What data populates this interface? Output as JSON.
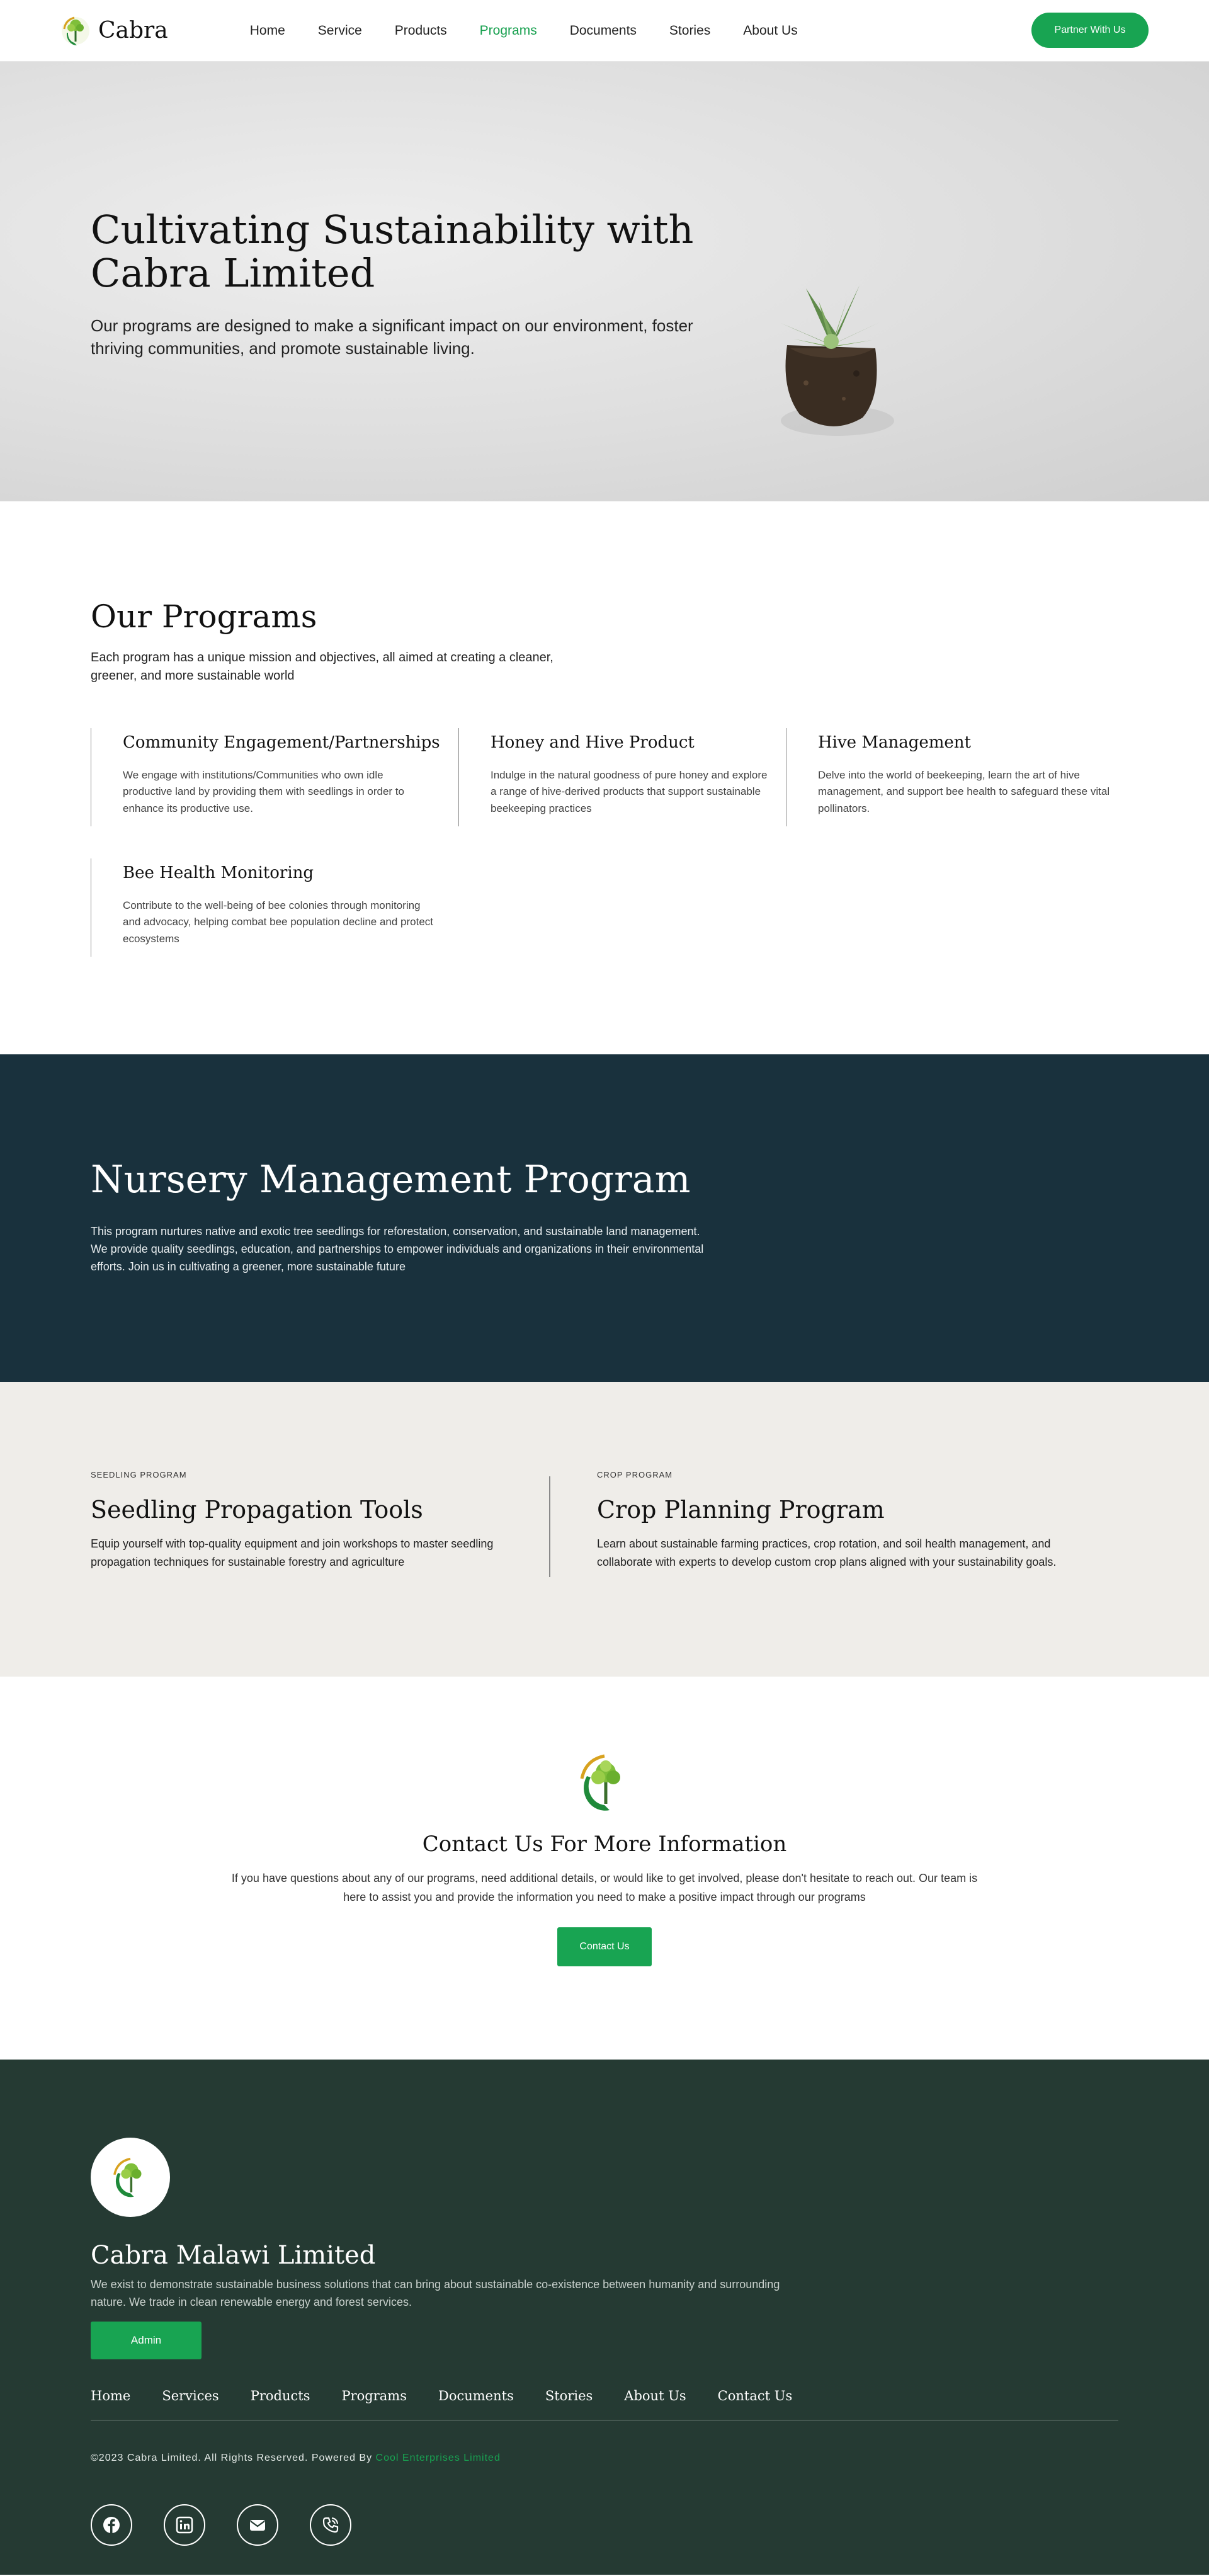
{
  "brand": {
    "name": "Cabra",
    "logo_icon": "tree-logo-icon"
  },
  "nav": {
    "links": [
      "Home",
      "Service",
      "Products",
      "Programs",
      "Documents",
      "Stories",
      "About Us"
    ],
    "active": "Programs",
    "cta": "Partner With Us"
  },
  "hero": {
    "title": "Cultivating Sustainability with Cabra Limited",
    "subtitle": "Our programs are designed to make a significant impact on our environment, foster thriving communities, and promote sustainable living."
  },
  "programs": {
    "title": "Our Programs",
    "subtitle": "Each program has a unique mission and objectives, all aimed at creating a cleaner, greener, and more sustainable world",
    "items": [
      {
        "title": "Community Engagement/Partnerships",
        "text": "We engage with institutions/Communities who own idle productive land by providing them with seedlings in order to enhance its productive use."
      },
      {
        "title": "Honey and Hive Product",
        "text": "Indulge in the natural goodness of pure honey and explore a range of hive-derived products that support sustainable beekeeping practices"
      },
      {
        "title": "Hive Management",
        "text": "Delve into the world of beekeeping, learn the art of hive management, and support bee health to safeguard these vital pollinators."
      },
      {
        "title": "Bee Health Monitoring",
        "text": "Contribute to the well-being of bee colonies through monitoring and advocacy, helping combat bee population decline and protect ecosystems"
      }
    ]
  },
  "nursery": {
    "title": "Nursery Management Program",
    "text": "This program nurtures native and exotic tree seedlings for reforestation, conservation, and sustainable land management. We provide quality seedlings, education, and partnerships to empower individuals and organizations in their environmental efforts. Join us in cultivating a greener, more sustainable future"
  },
  "tools": [
    {
      "eyebrow": "SEEDLING PROGRAM",
      "title": "Seedling Propagation Tools",
      "text": "Equip yourself with top-quality equipment and join workshops to master seedling propagation techniques for sustainable forestry and agriculture"
    },
    {
      "eyebrow": "CROP PROGRAM",
      "title": "Crop Planning Program",
      "text": "Learn about sustainable farming practices, crop rotation, and soil health management, and collaborate with experts to develop custom crop plans aligned with your sustainability goals."
    }
  ],
  "contact": {
    "title": "Contact Us For More Information",
    "text": "If you have questions about any of our programs, need additional details, or would like to get involved, please don't hesitate to reach out. Our team is here to assist you and provide the information you need to make a positive impact through our programs",
    "button": "Contact Us"
  },
  "footer": {
    "name": "Cabra Malawi Limited",
    "description": "We exist to demonstrate sustainable business solutions that can bring about sustainable co-existence between humanity and surrounding nature. We trade in clean renewable energy and forest services.",
    "admin_button": "Admin",
    "links": [
      "Home",
      "Services",
      "Products",
      "Programs",
      "Documents",
      "Stories",
      "About Us",
      "Contact Us"
    ],
    "copyright_prefix": "©2023 Cabra Limited. All Rights Reserved. Powered By ",
    "copyright_link": "Cool Enterprises Limited",
    "socials": [
      "facebook-icon",
      "linkedin-icon",
      "email-icon",
      "phone-icon"
    ]
  },
  "colors": {
    "accent": "#18a452",
    "navy": "#19313d",
    "footer": "#253a33",
    "sand": "#efede9"
  }
}
